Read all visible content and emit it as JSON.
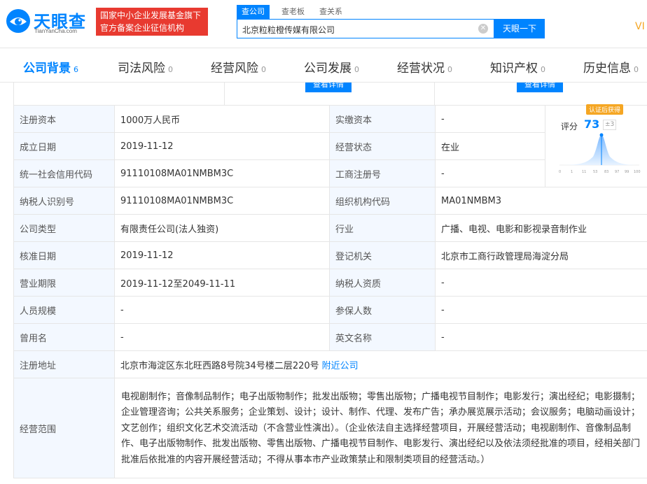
{
  "header": {
    "logo_text": "天眼查",
    "logo_sub": "TianYanCha.com",
    "banner_line1": "国家中小企业发展基金旗下",
    "banner_line2": "官方备案企业征信机构",
    "search_tabs": [
      "查公司",
      "查老板",
      "查关系"
    ],
    "search_value": "北京粒粒橙传媒有限公司",
    "search_button": "天眼一下",
    "vip": "VI"
  },
  "nav": {
    "items": [
      {
        "label": "公司背景",
        "count": "6",
        "active": true
      },
      {
        "label": "司法风险",
        "count": "0"
      },
      {
        "label": "经营风险",
        "count": "0"
      },
      {
        "label": "公司发展",
        "count": "0"
      },
      {
        "label": "经营状况",
        "count": "0"
      },
      {
        "label": "知识产权",
        "count": "0"
      },
      {
        "label": "历史信息",
        "count": "0"
      }
    ]
  },
  "peek": {
    "detail_btn": "查看详情"
  },
  "score": {
    "label": "评分",
    "value": "73",
    "delta": "±3",
    "badge": "认证后获得",
    "ticks": [
      "0",
      "1",
      "11",
      "53",
      "83",
      "97",
      "99",
      "100"
    ]
  },
  "info": {
    "reg_capital_label": "注册资本",
    "reg_capital": "1000万人民币",
    "paid_capital_label": "实缴资本",
    "paid_capital": "-",
    "found_date_label": "成立日期",
    "found_date": "2019-11-12",
    "status_label": "经营状态",
    "status": "在业",
    "credit_code_label": "统一社会信用代码",
    "credit_code": "91110108MA01NMBM3C",
    "biz_reg_no_label": "工商注册号",
    "biz_reg_no": "-",
    "tax_id_label": "纳税人识别号",
    "tax_id": "91110108MA01NMBM3C",
    "org_code_label": "组织机构代码",
    "org_code": "MA01NMBM3",
    "company_type_label": "公司类型",
    "company_type": "有限责任公司(法人独资)",
    "industry_label": "行业",
    "industry": "广播、电视、电影和影视录音制作业",
    "approve_date_label": "核准日期",
    "approve_date": "2019-11-12",
    "reg_authority_label": "登记机关",
    "reg_authority": "北京市工商行政管理局海淀分局",
    "biz_term_label": "营业期限",
    "biz_term": "2019-11-12至2049-11-11",
    "taxpayer_qual_label": "纳税人资质",
    "taxpayer_qual": "-",
    "staff_size_label": "人员规模",
    "staff_size": "-",
    "insured_label": "参保人数",
    "insured": "-",
    "former_name_label": "曾用名",
    "former_name": "-",
    "english_name_label": "英文名称",
    "english_name": "-",
    "address_label": "注册地址",
    "address": "北京市海淀区东北旺西路8号院34号楼二层220号",
    "nearby_link": "附近公司",
    "scope_label": "经营范围",
    "scope": "电视剧制作；音像制品制作；电子出版物制作；批发出版物；零售出版物；广播电视节目制作；电影发行；演出经纪；电影摄制；企业管理咨询；公共关系服务；企业策划、设计；设计、制作、代理、发布广告；承办展览展示活动；会议服务；电脑动画设计；文艺创作；组织文化艺术交流活动（不含营业性演出）。（企业依法自主选择经营项目，开展经营活动；电视剧制作、音像制品制作、电子出版物制作、批发出版物、零售出版物、广播电视节目制作、电影发行、演出经纪以及依法须经批准的项目，经相关部门批准后依批准的内容开展经营活动；不得从事本市产业政策禁止和限制类项目的经营活动。）"
  }
}
